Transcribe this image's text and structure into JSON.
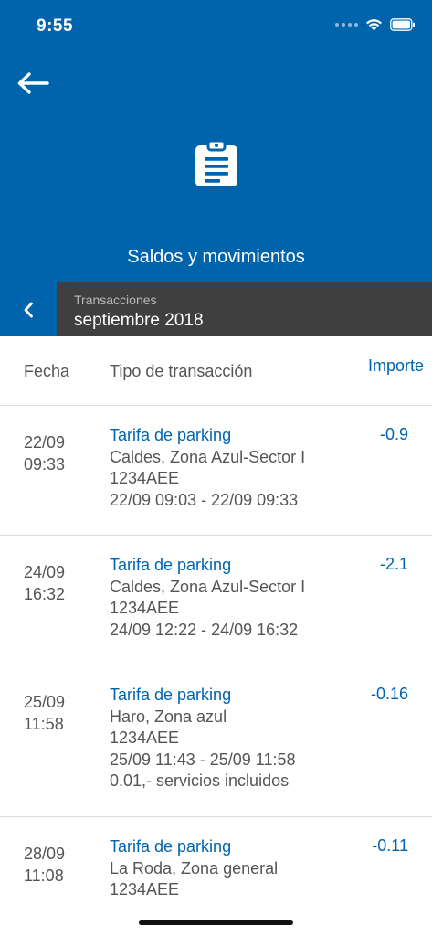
{
  "status_bar": {
    "time": "9:55"
  },
  "header": {
    "back_icon": "arrow-left-icon",
    "hero_icon": "clipboard-list-icon",
    "title": "Saldos y movimientos"
  },
  "period": {
    "label": "Transacciones",
    "value": "septiembre 2018",
    "prev_icon": "chevron-left-icon"
  },
  "table": {
    "columns": {
      "date": "Fecha",
      "type": "Tipo de transacción",
      "amount": "Importe"
    },
    "rows": [
      {
        "date": "22/09",
        "time": "09:33",
        "title": "Tarifa de parking",
        "location": "Caldes, Zona Azul-Sector I",
        "plate": "1234AEE",
        "range": "22/09 09:03 - 22/09 09:33",
        "amount": "-0.9"
      },
      {
        "date": "24/09",
        "time": "16:32",
        "title": "Tarifa de parking",
        "location": "Caldes, Zona Azul-Sector I",
        "plate": "1234AEE",
        "range": "24/09 12:22 - 24/09 16:32",
        "amount": "-2.1"
      },
      {
        "date": "25/09",
        "time": "11:58",
        "title": "Tarifa de parking",
        "location": "Haro, Zona azul",
        "plate": "1234AEE",
        "range": "25/09 11:43 - 25/09 11:58",
        "extra": "0.01,- servicios incluidos",
        "amount": "-0.16"
      },
      {
        "date": "28/09",
        "time": "11:08",
        "title": "Tarifa de parking",
        "location": "La Roda, Zona general",
        "plate": "1234AEE",
        "amount": "-0.11"
      }
    ]
  },
  "colors": {
    "brand_blue": "#0064ad",
    "period_panel": "#3f3f3f",
    "text_gray": "#555555"
  }
}
